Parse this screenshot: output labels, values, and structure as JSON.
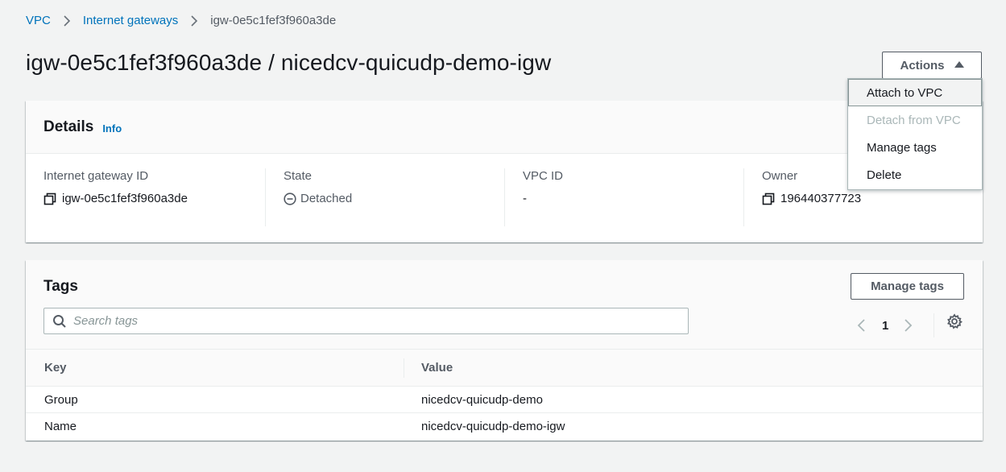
{
  "breadcrumb": {
    "items": [
      "VPC",
      "Internet gateways"
    ],
    "current": "igw-0e5c1fef3f960a3de"
  },
  "page_title": "igw-0e5c1fef3f960a3de / nicedcv-quicudp-demo-igw",
  "actions": {
    "label": "Actions",
    "menu": [
      {
        "label": "Attach to VPC",
        "state": "hover"
      },
      {
        "label": "Detach from VPC",
        "state": "disabled"
      },
      {
        "label": "Manage tags",
        "state": "enabled"
      },
      {
        "label": "Delete",
        "state": "enabled"
      }
    ]
  },
  "details": {
    "title": "Details",
    "info_link": "Info",
    "fields": [
      {
        "label": "Internet gateway ID",
        "value": "igw-0e5c1fef3f960a3de",
        "icon": "copy-icon"
      },
      {
        "label": "State",
        "value": "Detached",
        "icon": "minus-circle-icon"
      },
      {
        "label": "VPC ID",
        "value": "-",
        "icon": ""
      },
      {
        "label": "Owner",
        "value": "196440377723",
        "icon": "copy-icon"
      }
    ]
  },
  "tags": {
    "title": "Tags",
    "manage_label": "Manage tags",
    "search_placeholder": "Search tags",
    "page": "1",
    "columns": [
      "Key",
      "Value"
    ],
    "rows": [
      {
        "key": "Group",
        "value": "nicedcv-quicudp-demo"
      },
      {
        "key": "Name",
        "value": "nicedcv-quicudp-demo-igw"
      }
    ]
  },
  "colors": {
    "link": "#0073bb",
    "background": "#f2f3f3",
    "text": "#16191f",
    "muted": "#545b64",
    "disabled": "#aab7b8"
  }
}
